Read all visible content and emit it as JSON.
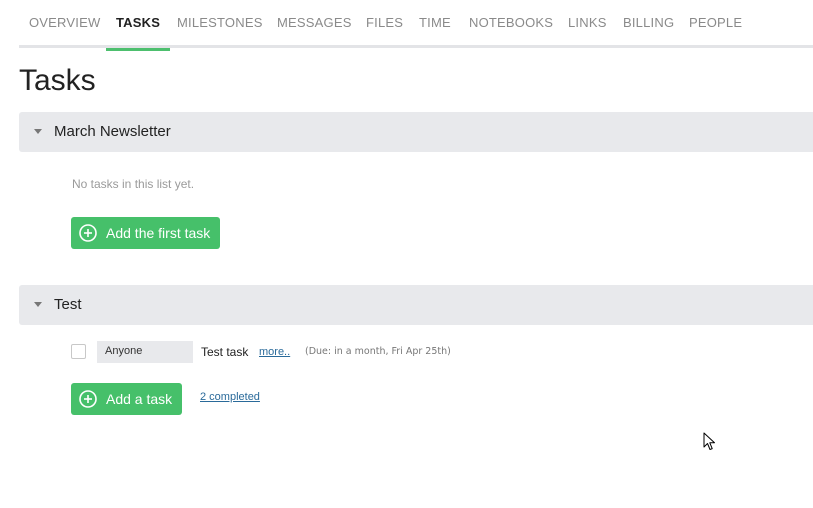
{
  "nav": {
    "tabs": [
      {
        "label": "OVERVIEW"
      },
      {
        "label": "TASKS",
        "active": true
      },
      {
        "label": "MILESTONES"
      },
      {
        "label": "MESSAGES"
      },
      {
        "label": "FILES"
      },
      {
        "label": "TIME"
      },
      {
        "label": "NOTEBOOKS"
      },
      {
        "label": "LINKS"
      },
      {
        "label": "BILLING"
      },
      {
        "label": "PEOPLE"
      }
    ]
  },
  "page": {
    "title": "Tasks"
  },
  "lists": [
    {
      "title": "March Newsletter",
      "empty_text": "No tasks in this list yet.",
      "add_button": "Add the first task"
    },
    {
      "title": "Test",
      "tasks": [
        {
          "assignee": "Anyone",
          "name": "Test task",
          "more_link": "more..",
          "due": "(Due: in a month, Fri Apr 25th)"
        }
      ],
      "add_button": "Add a task",
      "completed_link": "2 completed"
    }
  ],
  "colors": {
    "accent_green": "#46c06a",
    "tab_underline": "#4dbf6e",
    "header_bg": "#e8e9ec",
    "link": "#2a6a9a"
  },
  "icons": {
    "collapse": "caret-down-icon",
    "add": "plus-circle-icon",
    "cursor": "mouse-pointer-icon"
  }
}
